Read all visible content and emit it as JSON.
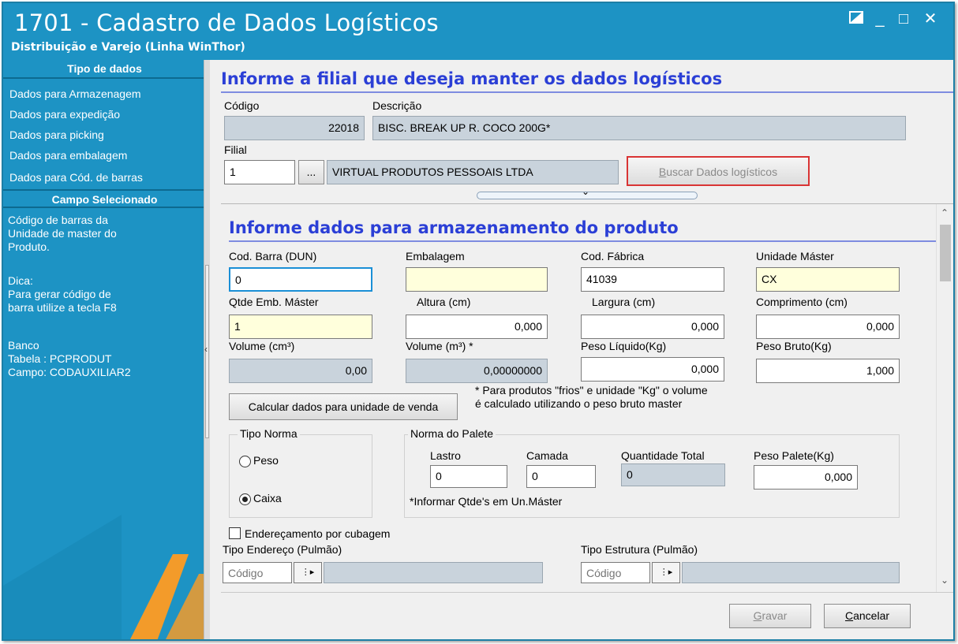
{
  "window": {
    "title": "1701 - Cadastro de Dados Logísticos",
    "subtitle": "Distribuição e Varejo (Linha WinThor)",
    "controls": {
      "restore_icon": "restore-icon",
      "minimize": "_",
      "maximize": "□",
      "close": "✕"
    }
  },
  "sidebar": {
    "header1": "Tipo de dados",
    "items": [
      {
        "label": "Dados para Armazenagem"
      },
      {
        "label": "Dados para expedição"
      },
      {
        "label": "Dados para picking"
      },
      {
        "label": "Dados para embalagem"
      },
      {
        "label": "Dados para Cód. de barras"
      }
    ],
    "header2": "Campo Selecionado",
    "field_desc": "Código de barras da\nUnidade de master do\nProduto.",
    "tip": "Dica:\nPara gerar código de\nbarra utilize a tecla F8",
    "db": "Banco\nTabela : PCPRODUT\nCampo: CODAUXILIAR2"
  },
  "filial_section": {
    "title": "Informe a filial que deseja manter os dados logísticos",
    "codigo_label": "Código",
    "codigo_value": "22018",
    "descricao_label": "Descrição",
    "descricao_value": "BISC. BREAK UP R. COCO 200G*",
    "filial_label": "Filial",
    "filial_value": "1",
    "filial_lookup": "...",
    "filial_name": "VIRTUAL PRODUTOS PESSOAIS LTDA",
    "buscar_button_accel": "B",
    "buscar_button_rest": "uscar Dados logísticos"
  },
  "armazenamento": {
    "title": "Informe dados para armazenamento do produto",
    "cod_barra_label": "Cod. Barra (DUN)",
    "cod_barra_value": "0",
    "embalagem_label": "Embalagem",
    "embalagem_value": "",
    "cod_fabrica_label": "Cod. Fábrica",
    "cod_fabrica_value": "41039",
    "unidade_master_label": "Unidade Máster",
    "unidade_master_value": "CX",
    "qtde_label": "Qtde Emb. Máster",
    "qtde_value": "1",
    "altura_label": "Altura (cm)",
    "altura_value": "0,000",
    "largura_label": "Largura (cm)",
    "largura_value": "0,000",
    "comprimento_label": "Comprimento (cm)",
    "comprimento_value": "0,000",
    "volume_cm_label": "Volume (cm³)",
    "volume_cm_value": "0,00",
    "volume_m_label": "Volume (m³) *",
    "volume_m_value": "0,00000000",
    "peso_liquido_label": "Peso Líquido(Kg)",
    "peso_liquido_value": "0,000",
    "peso_bruto_label": "Peso Bruto(Kg)",
    "peso_bruto_value": "1,000",
    "calcular_button": "Calcular dados para unidade de venda",
    "frios_note": "* Para produtos \"frios\" e unidade \"Kg\" o volume\né calculado utilizando o peso bruto master"
  },
  "tipo_norma": {
    "title": "Tipo Norma",
    "peso_label": "Peso",
    "caixa_label": "Caixa",
    "selected": "Caixa"
  },
  "norma_palete": {
    "title": "Norma do Palete",
    "lastro_label": "Lastro",
    "lastro_value": "0",
    "camada_label": "Camada",
    "camada_value": "0",
    "qtd_total_label": "Quantidade Total",
    "qtd_total_value": "0",
    "peso_palete_label": "Peso Palete(Kg)",
    "peso_palete_value": "0,000",
    "note": "*Informar Qtde's em Un.Máster"
  },
  "enderecamento": {
    "checkbox_label": "Endereçamento por cubagem",
    "tipo_endereco_label": "Tipo Endereço (Pulmão)",
    "tipo_endereco_placeholder": "Código",
    "tipo_estrutura_label": "Tipo Estrutura (Pulmão)",
    "tipo_estrutura_placeholder": "Código"
  },
  "footer": {
    "gravar_accel": "G",
    "gravar_rest": "ravar",
    "cancelar_accel": "C",
    "cancelar_rest": "ancelar"
  }
}
